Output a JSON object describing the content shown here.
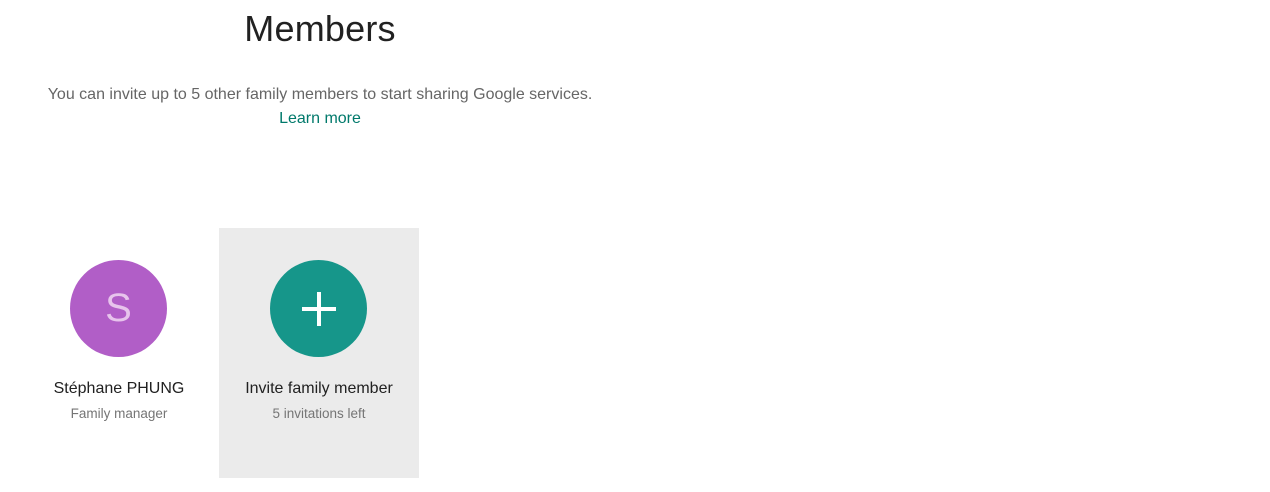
{
  "header": {
    "title": "Members",
    "subtitle": "You can invite up to 5 other family members to start sharing Google services.",
    "learn_more": "Learn more"
  },
  "members": [
    {
      "initial": "S",
      "name": "Stéphane PHUNG",
      "role": "Family manager",
      "avatar_color": "#b15ec7"
    }
  ],
  "invite": {
    "label": "Invite family member",
    "sublabel": "5 invitations left",
    "button_color": "#16968a",
    "icon": "plus-icon"
  },
  "colors": {
    "link": "#00796b",
    "card_bg": "#ebebeb"
  }
}
